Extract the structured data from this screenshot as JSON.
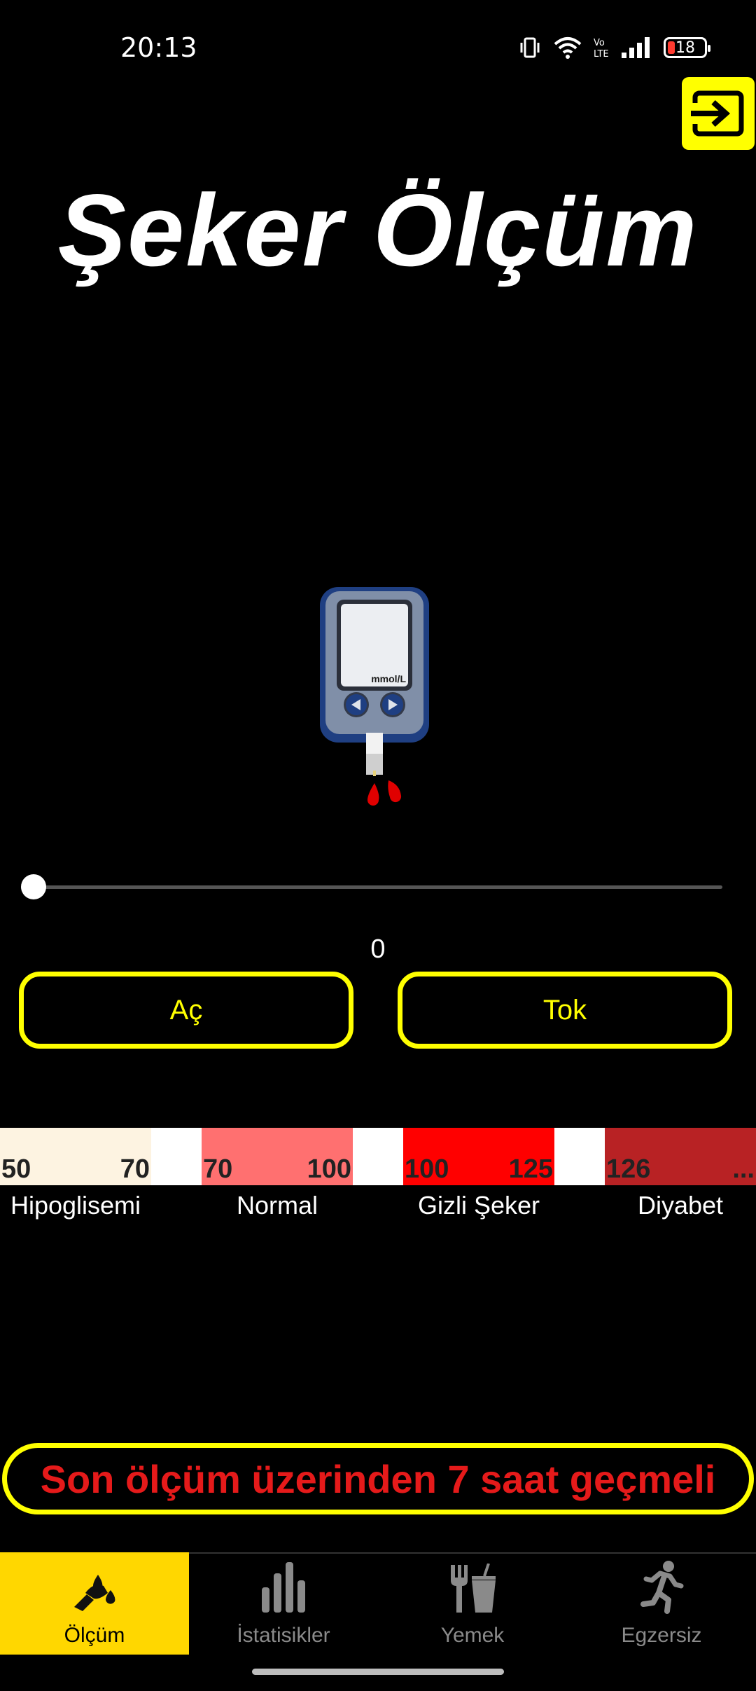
{
  "status_bar": {
    "time": "20:13",
    "battery": "18"
  },
  "page": {
    "title": "Şeker Ölçüm"
  },
  "meter": {
    "unit": "mmol/L"
  },
  "slider": {
    "value": "0",
    "level": 0
  },
  "buttons": {
    "fasting": "Aç",
    "fed": "Tok"
  },
  "ranges": [
    {
      "low": "50",
      "high": "70",
      "label": "Hipoglisemi",
      "color": "#fdf3e1"
    },
    {
      "low": "70",
      "high": "100",
      "label": "Normal",
      "color": "#ff7070"
    },
    {
      "low": "100",
      "high": "125",
      "label": "Gizli Şeker",
      "color": "#ff0000"
    },
    {
      "low": "126",
      "high": "...",
      "label": "Diyabet",
      "color": "#b82224"
    }
  ],
  "warning": "Son ölçüm üzerinden 7 saat geçmeli",
  "nav": [
    {
      "label": "Ölçüm",
      "icon": "blood-drop-hand-icon",
      "active": true
    },
    {
      "label": "İstatisikler",
      "icon": "bar-chart-icon",
      "active": false
    },
    {
      "label": "Yemek",
      "icon": "fork-cup-icon",
      "active": false
    },
    {
      "label": "Egzersiz",
      "icon": "running-person-icon",
      "active": false
    }
  ],
  "colors": {
    "accent": "#ffff00",
    "warning_text": "#e51a1a",
    "nav_active": "#ffd700"
  }
}
